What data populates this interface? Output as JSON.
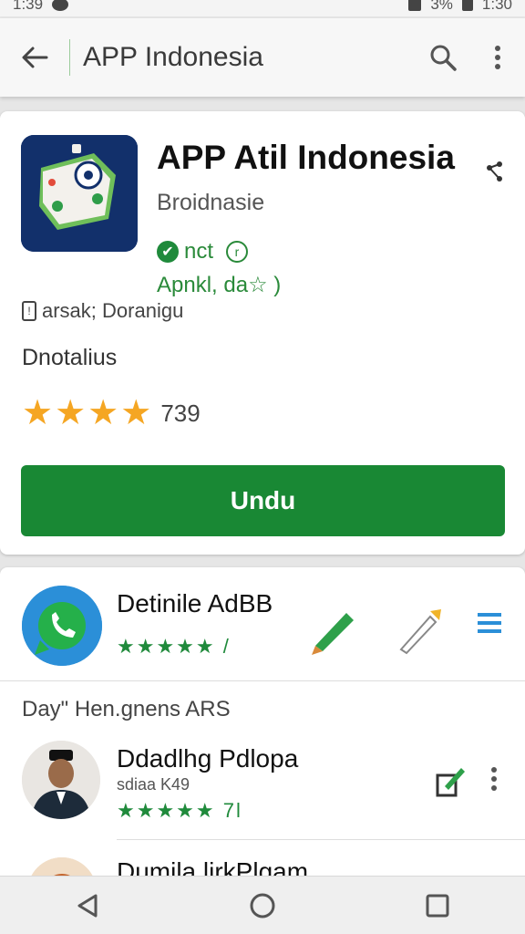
{
  "status_bar": {
    "time": "1:39",
    "time_right": "1:30",
    "battery": "3%"
  },
  "app_bar": {
    "title": "APP Indonesia"
  },
  "app": {
    "title": "APP Atil Indonesia",
    "developer": "Broidnasie",
    "badge_text": "nct",
    "rating_text": "Apnkl, da☆ )",
    "ad_text": "arsak; Doranigu",
    "category": "Dnotalius",
    "rating_count": "739",
    "install_label": "Undu",
    "accent_color": "#198834"
  },
  "featured": {
    "name": "Detinile AdBB",
    "stars": "★★★★★ /"
  },
  "section_label": "Day\" Hen.gnens ARS",
  "reviews": [
    {
      "name": "Ddadlhg Pdlopa",
      "sub": "sdiaa K49",
      "stars": "★★★★★ 7l"
    },
    {
      "name": "Dumila lirkPlgam"
    }
  ]
}
